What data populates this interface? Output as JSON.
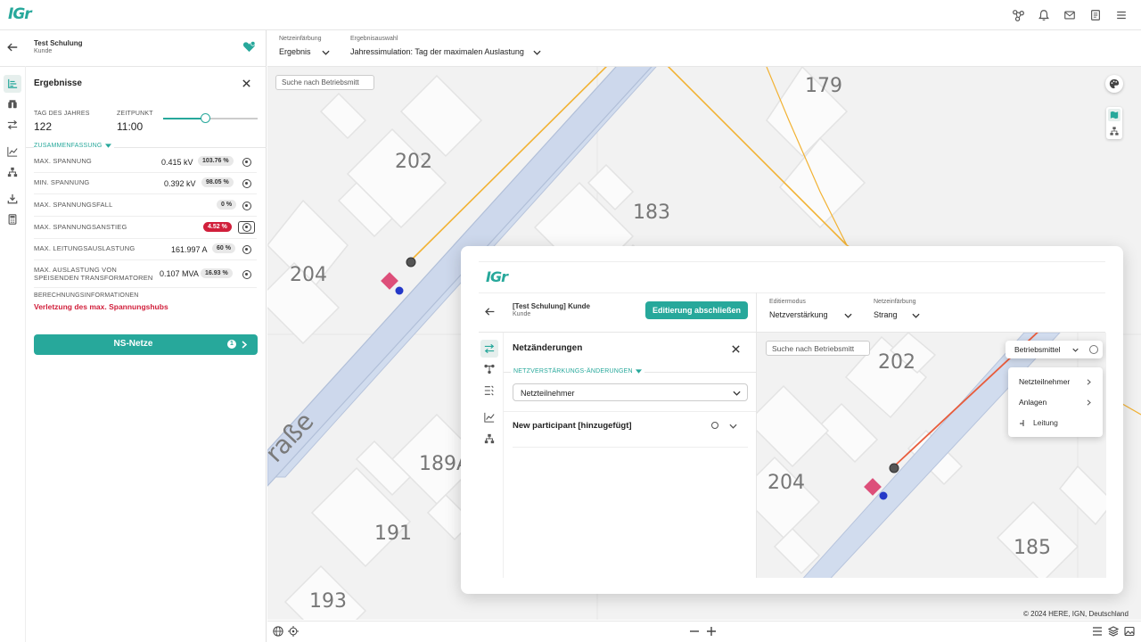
{
  "app": {
    "logo": "IGr"
  },
  "top_icons": [
    "network-icon",
    "bell-icon",
    "mail-icon",
    "document-icon",
    "menu-icon"
  ],
  "project": {
    "title": "Test Schulung",
    "subtitle": "Kunde"
  },
  "results_panel": {
    "title": "Ergebnisse",
    "day_label": "TAG DES JAHRES",
    "day_value": "122",
    "time_label": "ZEITPUNKT",
    "time_value": "11:00",
    "time_slider_fraction": 0.45,
    "summary_label": "ZUSAMMENFASSUNG",
    "metrics": [
      {
        "label": "MAX. SPANNUNG",
        "value": "0.415 kV",
        "badge": "103.76 %",
        "alert": false
      },
      {
        "label": "MIN. SPANNUNG",
        "value": "0.392 kV",
        "badge": "98.05 %",
        "alert": false
      },
      {
        "label": "MAX. SPANNUNGSFALL",
        "value": "",
        "badge": "0 %",
        "alert": false
      },
      {
        "label": "MAX. SPANNUNGSANSTIEG",
        "value": "",
        "badge": "4.52 %",
        "alert": true
      },
      {
        "label": "MAX. LEITUNGSAUSLASTUNG",
        "value": "161.997 A",
        "badge": "60 %",
        "alert": false
      },
      {
        "label": "MAX. AUSLASTUNG VON SPEISENDEN TRANSFORMATOREN",
        "label_line1": "MAX. AUSLASTUNG VON",
        "label_line2": "SPEISENDEN TRANSFORMATOREN",
        "value": "0.107 MVA",
        "badge": "16.93 %",
        "alert": false
      }
    ],
    "calc_info_label": "BERECHNUNGSINFORMATIONEN",
    "calc_info_warning": "Verletzung des max. Spannungshubs",
    "ns_button_label": "NS-Netze",
    "ns_button_count": "1"
  },
  "filters": {
    "coloring_label": "Netzeinfärbung",
    "coloring_value": "Ergebnis",
    "result_label": "Ergebnisauswahl",
    "result_value": "Jahressimulation: Tag der maximalen Auslastung"
  },
  "map": {
    "search_placeholder": "Suche nach Betriebsmitt",
    "house_numbers": [
      "179",
      "202",
      "183",
      "204",
      "189A",
      "191",
      "193"
    ],
    "street_label": "raße",
    "copyright": "© 2024 HERE, IGN, Deutschland"
  },
  "card": {
    "logo": "IGr",
    "project_title": "[Test Schulung] Kunde",
    "project_subtitle": "Kunde",
    "finish_button": "Editierung abschließen",
    "edit_mode_label": "Editiermodus",
    "edit_mode_value": "Netzverstärkung",
    "coloring_label": "Netzeinfärbung",
    "coloring_value": "Strang",
    "panel_title": "Netzänderungen",
    "section_label": "NETZVERSTÄRKUNGS-ÄNDERUNGEN",
    "select_value": "Netzteilnehmer",
    "participant_label": "New participant [hinzugefügt]",
    "search_placeholder": "Suche nach Betriebsmitt",
    "asset_dropdown": "Betriebsmittel",
    "menu_items": [
      "Netzteilnehmer",
      "Anlagen",
      "Leitung"
    ],
    "house_numbers": [
      "202",
      "204",
      "185"
    ]
  },
  "colors": {
    "accent": "#27a89b",
    "alert": "#d11f3b",
    "road": "#c9d5ea",
    "line_orange": "#f2b233"
  }
}
